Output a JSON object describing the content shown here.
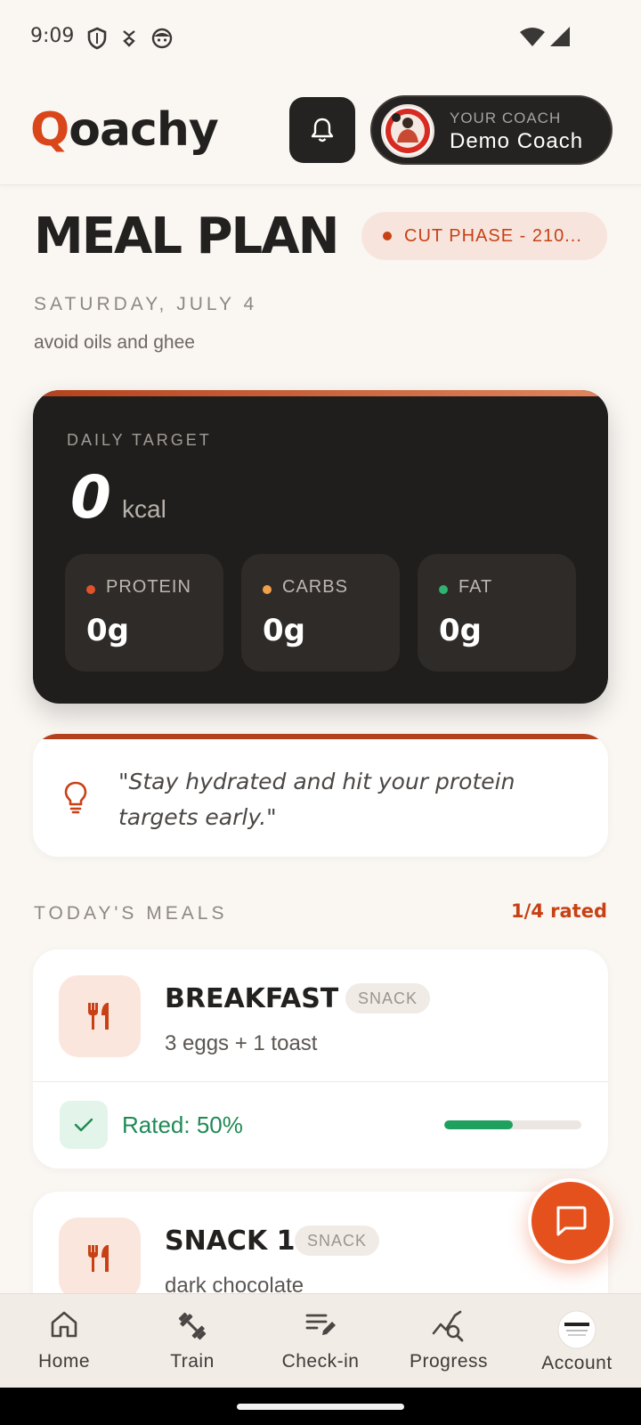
{
  "status": {
    "time": "9:09",
    "left_icons": [
      "shield-icon",
      "app-notification-icon",
      "face-icon"
    ],
    "right_icons": [
      "wifi-icon",
      "signal-icon"
    ]
  },
  "header": {
    "logo_first_letter": "Q",
    "logo_rest": "oachy",
    "coach_label": "YOUR COACH",
    "coach_name": "Demo Coach"
  },
  "page": {
    "title": "MEAL PLAN",
    "phase_badge": "CUT PHASE - 210...",
    "date": "SATURDAY, JULY 4",
    "note": "avoid oils and ghee"
  },
  "daily_target": {
    "label": "DAILY TARGET",
    "kcal_value": "0",
    "kcal_unit": "kcal",
    "macros": [
      {
        "name": "PROTEIN",
        "value": "0g",
        "color": "#e0532a"
      },
      {
        "name": "CARBS",
        "value": "0g",
        "color": "#f0a04b"
      },
      {
        "name": "FAT",
        "value": "0g",
        "color": "#2fb36f"
      }
    ]
  },
  "tip": {
    "text": "\"Stay hydrated and hit your protein targets early.\""
  },
  "meals_section": {
    "heading": "TODAY'S MEALS",
    "rated_count": "1/4 rated"
  },
  "meals": [
    {
      "name": "BREAKFAST",
      "tag": "SNACK",
      "description": "3 eggs + 1 toast",
      "rated_label": "Rated: 50%",
      "rated_fraction": 0.5
    },
    {
      "name": "SNACK 1",
      "tag": "SNACK",
      "description": "dark chocolate"
    }
  ],
  "nav": {
    "items": [
      {
        "label": "Home",
        "icon": "home-icon"
      },
      {
        "label": "Train",
        "icon": "dumbbell-icon"
      },
      {
        "label": "Check-in",
        "icon": "checkin-icon"
      },
      {
        "label": "Progress",
        "icon": "progress-icon"
      },
      {
        "label": "Account",
        "icon": "account-avatar"
      }
    ]
  },
  "colors": {
    "accent": "#d9461a",
    "dark": "#201e1c",
    "background": "#faf6f2",
    "success": "#1f8a55"
  }
}
